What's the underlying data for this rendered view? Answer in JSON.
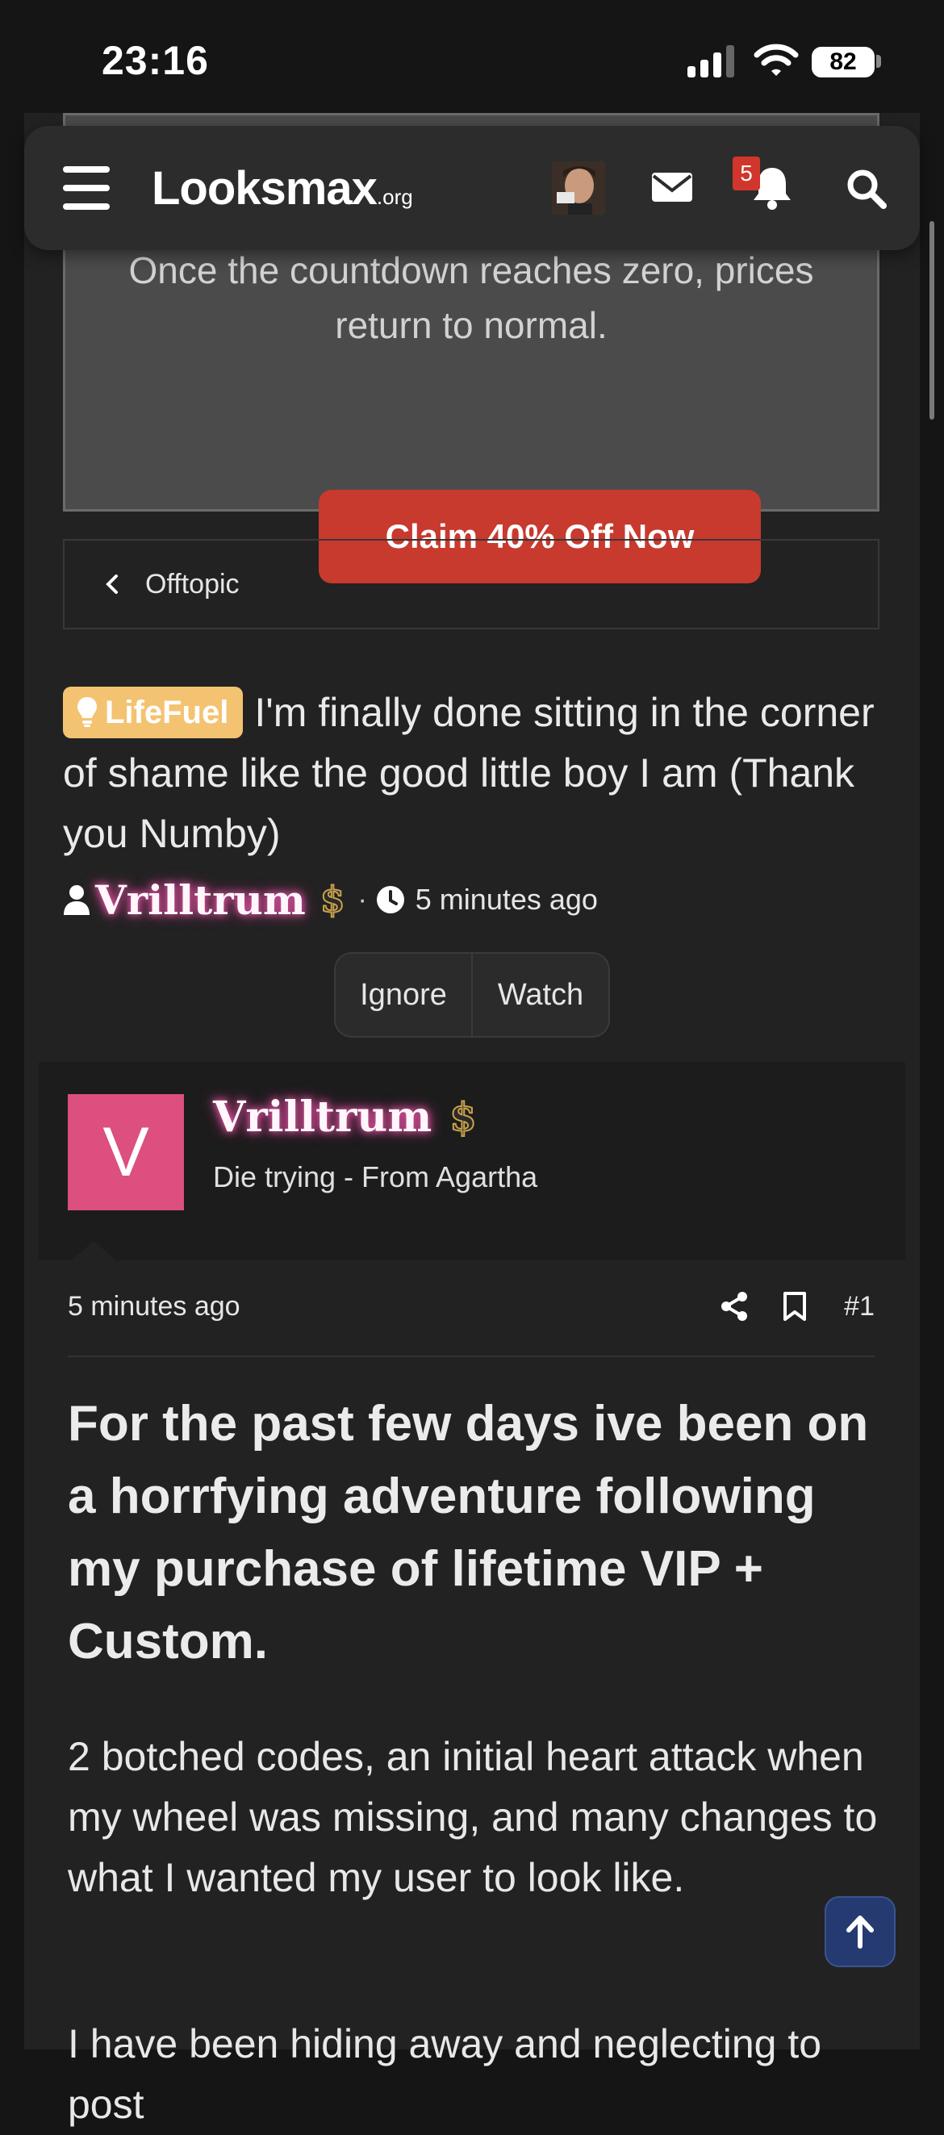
{
  "status_bar": {
    "time": "23:16",
    "battery": "82"
  },
  "nav": {
    "logo": "Looksmax",
    "logo_suffix": ".org",
    "notifications_count": "5"
  },
  "promo": {
    "text_line1": "Once the countdown reaches zero, prices",
    "text_line2": "return to normal.",
    "button_label": "Claim 40% Off Now"
  },
  "breadcrumb": {
    "label": "Offtopic"
  },
  "thread": {
    "prefix": "LifeFuel",
    "title": "I'm finally done sitting in the corner of shame like the good little boy I am (Thank you Numby)",
    "author": "Vrilltrum",
    "badge": "$",
    "time_ago": "5 minutes ago",
    "ignore_label": "Ignore",
    "watch_label": "Watch"
  },
  "post": {
    "avatar_letter": "V",
    "username": "Vrilltrum",
    "badge": "$",
    "user_title": "Die trying - From Agartha",
    "date": "5 minutes ago",
    "number": "#1",
    "heading": "For the past few days ive been on a horrfying adventure following my purchase of lifetime VIP + Custom.",
    "paragraph1": "2 botched codes, an initial heart attack when my wheel was missing, and many changes to what I wanted my user to look like.",
    "paragraph2": "I have been hiding away and neglecting to post"
  },
  "colors": {
    "accent_red": "#c8392e",
    "avatar_pink": "#dc4f7f",
    "prefix_yellow": "#f3c372",
    "scroll_top_blue": "#243a70"
  }
}
